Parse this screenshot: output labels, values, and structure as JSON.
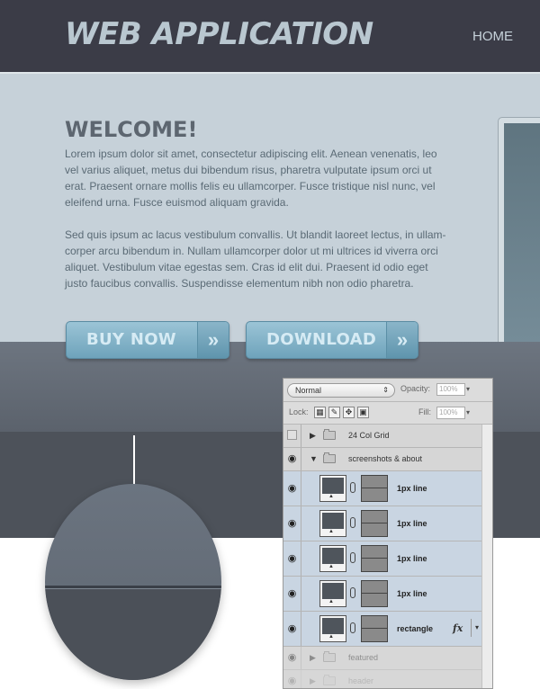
{
  "header": {
    "logo": "WEB APPLICATION",
    "nav_home": "HOME"
  },
  "hero": {
    "title": "WELCOME!",
    "paragraph_1": "Lorem ipsum dolor sit amet, consectetur adipiscing elit. Aenean venenatis, leo vel varius aliquet, metus dui bibendum risus, pharetra vulputate ipsum orci ut erat. Praesent ornare mollis felis eu ullamcorper. Fusce tristique nisl nunc, vel eleifend urna. Fusce euismod aliquam gravida.",
    "paragraph_2": "Sed quis ipsum ac lacus vestibulum convallis. Ut blandit laoreet lectus, in ullam-corper arcu bibendum in. Nullam ullamcorper dolor ut mi ultrices id viverra orci aliquet. Vestibulum vitae egestas sem. Cras id elit dui. Praesent id odio eget justo faucibus convallis. Suspendisse elementum nibh non odio pharetra."
  },
  "buttons": {
    "buy_label": "BUY NOW",
    "download_label": "DOWNLOAD",
    "arrow_glyph": "»"
  },
  "layers_panel": {
    "blend_mode": "Normal",
    "opacity_label": "Opacity:",
    "opacity_value": "100%",
    "lock_label": "Lock:",
    "fill_label": "Fill:",
    "fill_value": "100%",
    "layers": [
      {
        "name": "24 Col Grid",
        "type": "group",
        "visible": false,
        "expanded": false
      },
      {
        "name": "screenshots & about",
        "type": "group",
        "visible": true,
        "expanded": true
      },
      {
        "name": "1px line",
        "type": "layer",
        "visible": true
      },
      {
        "name": "1px line",
        "type": "layer",
        "visible": true
      },
      {
        "name": "1px line",
        "type": "layer",
        "visible": true
      },
      {
        "name": "1px line",
        "type": "layer",
        "visible": true
      },
      {
        "name": "rectangle",
        "type": "layer",
        "visible": true,
        "fx": "fx"
      },
      {
        "name": "featured",
        "type": "group",
        "visible": true,
        "expanded": false
      },
      {
        "name": "header",
        "type": "group",
        "visible": true,
        "expanded": false
      }
    ]
  },
  "colors": {
    "topbar": "#3b3c47",
    "hero_bg": "#c6d1d9",
    "button_blue": "#7fb0c6",
    "dark_band": "#4d525a"
  }
}
